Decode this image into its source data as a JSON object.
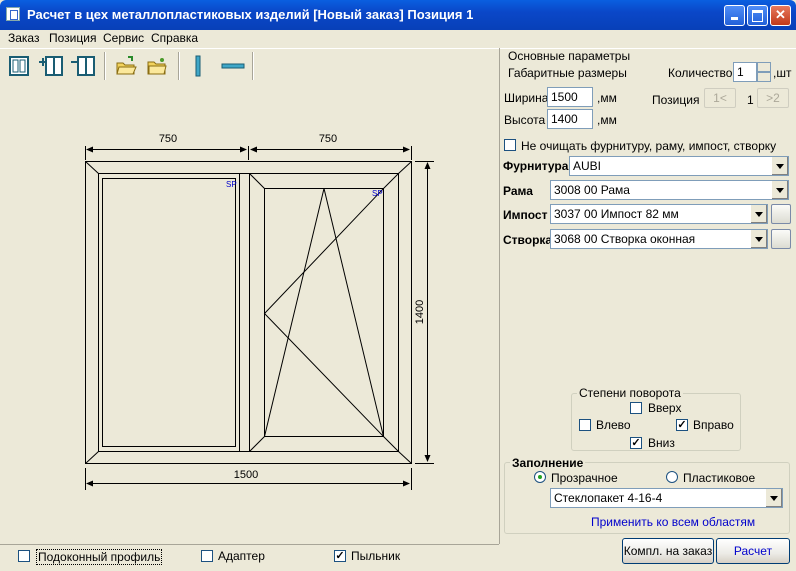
{
  "window": {
    "title": "Расчет в цех металлопластиковых изделий [Новый заказ] Позиция 1",
    "accent": "#0A47C8"
  },
  "menu": [
    "Заказ",
    "Позиция",
    "Сервис",
    "Справка"
  ],
  "toolbar": {
    "icons": [
      "add-frame-icon",
      "add-sash-icon",
      "remove-sash-icon",
      "open-folder-icon",
      "folder-icon",
      "vertical-mullion-icon",
      "horizontal-mullion-icon"
    ]
  },
  "drawing": {
    "width_mm": 1500,
    "height_mm": 1400,
    "section_left_mm": 750,
    "section_right_mm": 750,
    "dim_top_left": "750",
    "dim_top_right": "750",
    "dim_bottom": "1500",
    "dim_right": "1400",
    "sash_mark_left": "SP",
    "sash_mark_right": "SP"
  },
  "params": {
    "group_title": "Основные параметры",
    "overall_label": "Габаритные размеры",
    "quantity_label": "Количество",
    "quantity_value": "1",
    "quantity_unit": ",шт",
    "width_label": "Ширина",
    "width_value": "1500",
    "width_unit": ",мм",
    "height_label": "Высота",
    "height_value": "1400",
    "height_unit": ",мм",
    "position_label": "Позиция",
    "position_prev": "1<",
    "position_value": "1",
    "position_next": ">2",
    "no_clear_label": "Не очищать фурнитуру, раму, импост, створку",
    "hardware_label": "Фурнитура",
    "hardware_value": "AUBI",
    "frame_label": "Рама",
    "frame_value": "3008 00 Рама",
    "mullion_label": "Импост",
    "mullion_value": "3037 00 Импост 82 мм",
    "sash_label": "Створка",
    "sash_value": "3068 00 Створка оконная"
  },
  "rotation": {
    "title": "Степени поворота",
    "up": "Вверх",
    "left": "Влево",
    "right": "Вправо",
    "down": "Вниз"
  },
  "filling": {
    "title": "Заполнение",
    "transparent": "Прозрачное",
    "plastic": "Пластиковое",
    "glass_value": "Стеклопакет 4-16-4",
    "apply_all": "Применить ко всем областям",
    "link_color": "#0000CC"
  },
  "bottom": {
    "sill_label": "Подоконный профиль",
    "adapter_label": "Адаптер",
    "dust_label": "Пыльник"
  },
  "buttons": {
    "compl": "Компл. на заказ",
    "calc": "Расчет"
  }
}
